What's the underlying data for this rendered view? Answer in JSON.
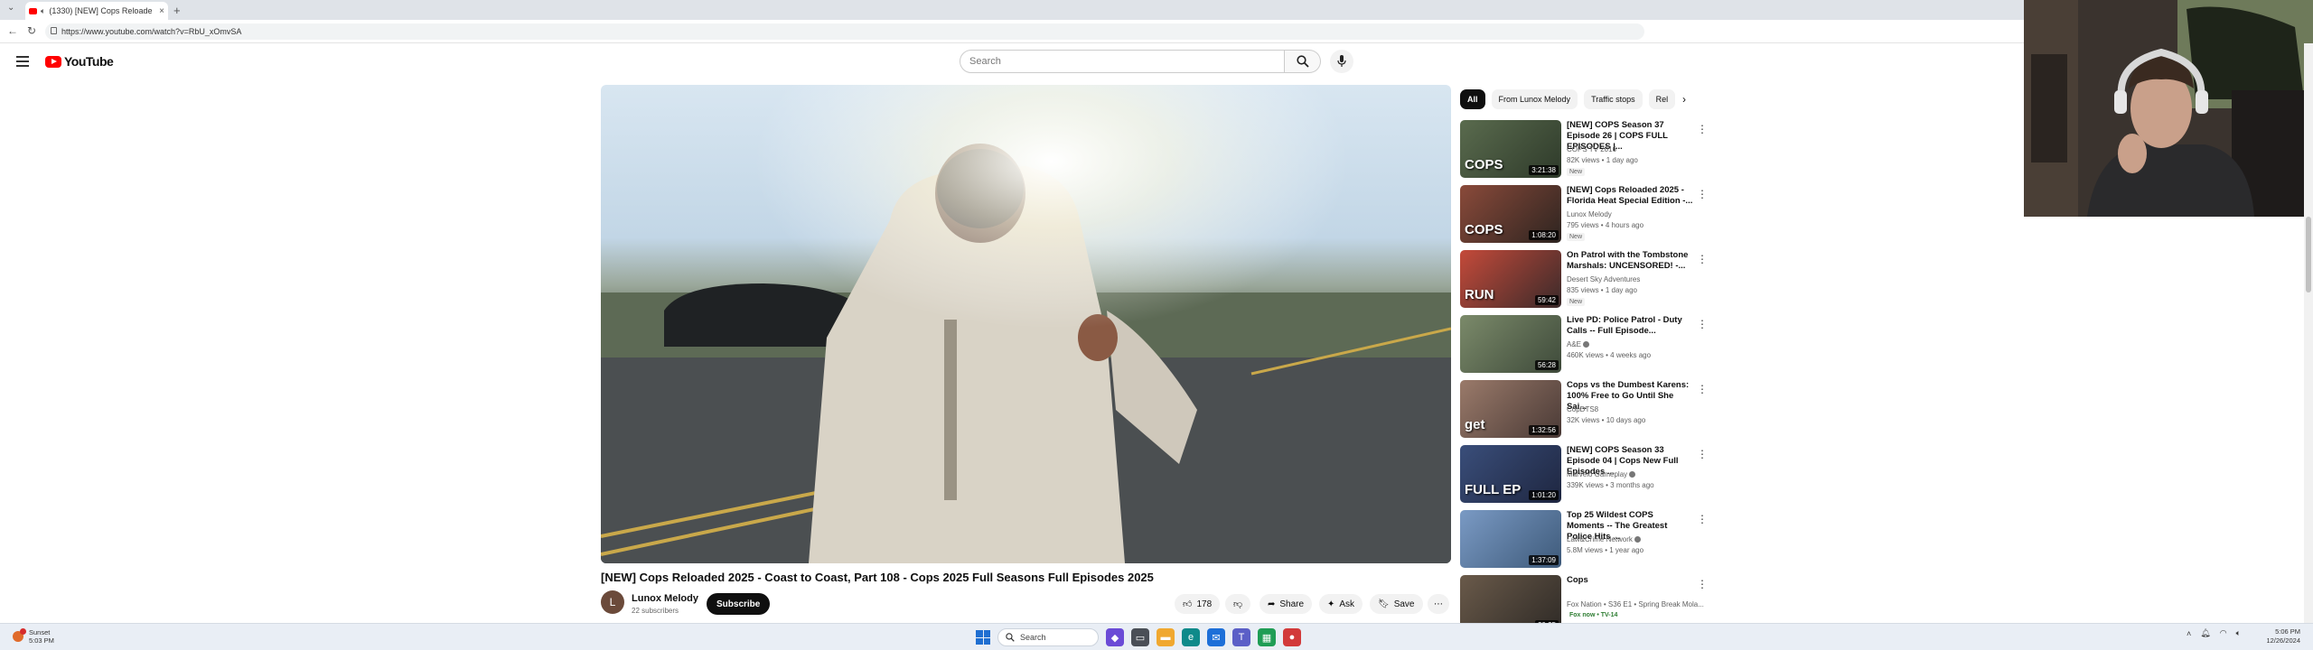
{
  "browser": {
    "tab_title": "(1330) [NEW] Cops Reloade",
    "url": "https://www.youtube.com/watch?v=RbU_xOmvSA"
  },
  "header": {
    "logo_text": "YouTube",
    "search_placeholder": "Search"
  },
  "video": {
    "title": "[NEW] Cops Reloaded 2025 - Coast to Coast, Part 108 - Cops 2025 Full Seasons Full Episodes 2025",
    "channel_initial": "L",
    "channel": "Lunox Melody",
    "subscribers": "22 subscribers",
    "subscribe_label": "Subscribe",
    "likes": "178",
    "share_label": "Share",
    "ask_label": "Ask",
    "save_label": "Save"
  },
  "chips": [
    "All",
    "From Lunox Melody",
    "Traffic stops",
    "Rel"
  ],
  "recommendations": [
    {
      "title": "[NEW] COPS Season 37 Episode 26 | COPS FULL EPISODES |...",
      "channel": "COPS TV 2016",
      "meta": "82K views • 1 day ago",
      "badge": "New",
      "duration": "3:21:38",
      "thumb_text": "COPS",
      "color_a": "#5a6b4e",
      "color_b": "#2e3a2a"
    },
    {
      "title": "[NEW] Cops Reloaded 2025 - Florida Heat Special Edition -...",
      "channel": "Lunox Melody",
      "meta": "795 views • 4 hours ago",
      "badge": "New",
      "duration": "1:08:20",
      "thumb_text": "COPS",
      "color_a": "#8a4a3a",
      "color_b": "#2d2420"
    },
    {
      "title": "On Patrol with the Tombstone Marshals: UNCENSORED! -...",
      "channel": "Desert Sky Adventures",
      "meta": "835 views • 1 day ago",
      "badge": "New",
      "duration": "59:42",
      "thumb_text": "RUN",
      "color_a": "#c44a3a",
      "color_b": "#3a2a2a"
    },
    {
      "title": "Live PD: Police Patrol - Duty Calls -- Full Episode...",
      "channel": "A&E",
      "meta": "460K views • 4 weeks ago",
      "badge": "",
      "duration": "56:28",
      "thumb_text": "",
      "color_a": "#7b8a6a",
      "color_b": "#3e4a3a"
    },
    {
      "title": "Cops vs the Dumbest Karens: 100% Free to Go Until She Sai...",
      "channel": "CopDTS8",
      "meta": "32K views • 10 days ago",
      "badge": "",
      "duration": "1:32:56",
      "thumb_text": "get",
      "color_a": "#9a7a6a",
      "color_b": "#4a3a36"
    },
    {
      "title": "[NEW] COPS Season 33 Episode 04 | Cops New Full Episodes ...",
      "channel": "Marvelo Gameplay",
      "meta": "339K views • 3 months ago",
      "badge": "",
      "duration": "1:01:20",
      "thumb_text": "FULL EP",
      "color_a": "#3a4e7a",
      "color_b": "#1e2640"
    },
    {
      "title": "Top 25 Wildest COPS Moments -- The Greatest Police Hits ...",
      "channel": "Law&Crime Network",
      "meta": "5.8M views • 1 year ago",
      "badge": "",
      "duration": "1:37:09",
      "thumb_text": "",
      "color_a": "#7a9ac4",
      "color_b": "#3e5a7a"
    },
    {
      "title": "Cops",
      "channel": "Fox Nation • S36 E1 • Spring Break Mola...",
      "meta": "",
      "badge": "Fox now • TV-14",
      "duration": "20:25",
      "thumb_text": "",
      "color_a": "#6a5a4a",
      "color_b": "#2e2a26"
    }
  ],
  "taskbar": {
    "weather_line1": "Sunset",
    "weather_line2": "5:03 PM",
    "search_label": "Search",
    "time": "5:06 PM",
    "date": "12/26/2024"
  }
}
